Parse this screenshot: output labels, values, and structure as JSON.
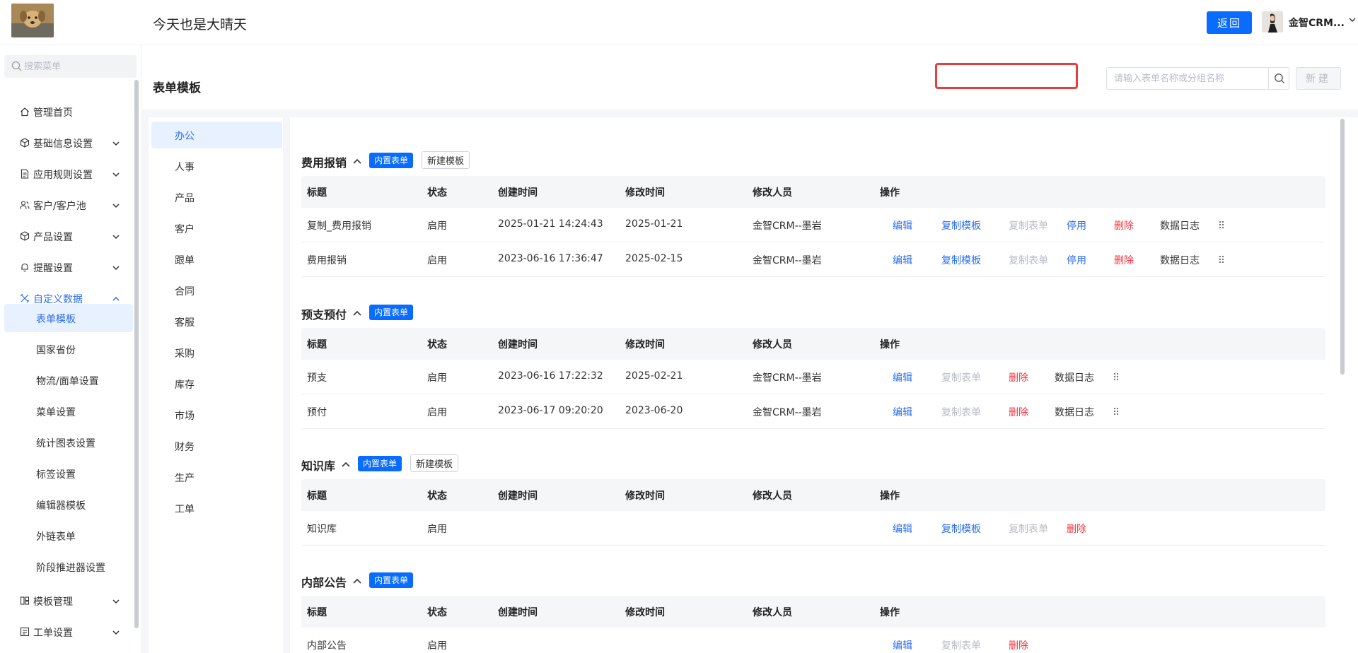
{
  "header": {
    "title": "今天也是大晴天",
    "back_label": "返回",
    "user_name": "金智CRM..."
  },
  "sidebar": {
    "search_placeholder": "搜索菜单",
    "items": [
      {
        "label": "管理首页",
        "icon": "home-icon"
      },
      {
        "label": "基础信息设置",
        "icon": "cube-icon"
      },
      {
        "label": "应用规则设置",
        "icon": "file-icon"
      },
      {
        "label": "客户/客户池",
        "icon": "users-icon"
      },
      {
        "label": "产品设置",
        "icon": "cube-icon"
      },
      {
        "label": "提醒设置",
        "icon": "bell-icon"
      },
      {
        "label": "自定义数据",
        "icon": "custom-icon"
      }
    ],
    "sub_items": [
      "表单模板",
      "国家省份",
      "物流/面单设置",
      "菜单设置",
      "统计图表设置",
      "标签设置",
      "编辑器模板",
      "外链表单",
      "阶段推进器设置"
    ],
    "bottom_items": [
      {
        "label": "模板管理",
        "icon": "template-icon"
      },
      {
        "label": "工单设置",
        "icon": "ticket-icon"
      }
    ]
  },
  "page": {
    "title": "表单模板",
    "search_placeholder": "请输入表单名称或分组名称",
    "new_label": "新建"
  },
  "categories": [
    "办公",
    "人事",
    "产品",
    "客户",
    "跟单",
    "合同",
    "客服",
    "采购",
    "库存",
    "市场",
    "财务",
    "生产",
    "工单"
  ],
  "table_headers": [
    "标题",
    "状态",
    "创建时间",
    "修改时间",
    "修改人员",
    "操作"
  ],
  "labels": {
    "builtin": "内置表单",
    "new_template": "新建模板",
    "edit": "编辑",
    "copy_template": "复制模板",
    "copy_form": "复制表单",
    "disable": "停用",
    "delete": "删除",
    "data_log": "数据日志"
  },
  "groups": [
    {
      "title": "费用报销",
      "rows": [
        {
          "title": "复制_费用报销",
          "status": "启用",
          "created": "2025-01-21 14:24:43",
          "modified": "2025-01-21",
          "modifier": "金智CRM--墨岩"
        },
        {
          "title": "费用报销",
          "status": "启用",
          "created": "2023-06-16 17:36:47",
          "modified": "2025-02-15",
          "modifier": "金智CRM--墨岩"
        }
      ]
    },
    {
      "title": "预支预付",
      "rows": [
        {
          "title": "预支",
          "status": "启用",
          "created": "2023-06-16 17:22:32",
          "modified": "2025-02-21",
          "modifier": "金智CRM--墨岩"
        },
        {
          "title": "预付",
          "status": "启用",
          "created": "2023-06-17 09:20:20",
          "modified": "2023-06-20",
          "modifier": "金智CRM--墨岩"
        }
      ]
    },
    {
      "title": "知识库",
      "rows": [
        {
          "title": "知识库",
          "status": "启用",
          "created": "",
          "modified": "",
          "modifier": ""
        }
      ]
    },
    {
      "title": "内部公告",
      "rows": [
        {
          "title": "内部公告",
          "status": "启用",
          "created": "",
          "modified": "",
          "modifier": ""
        }
      ]
    }
  ],
  "colors": {
    "primary": "#0a6cff",
    "link": "#2a6ef0",
    "danger": "#f5333f",
    "muted": "#b8bcc4",
    "highlight": "#e93c3c"
  }
}
